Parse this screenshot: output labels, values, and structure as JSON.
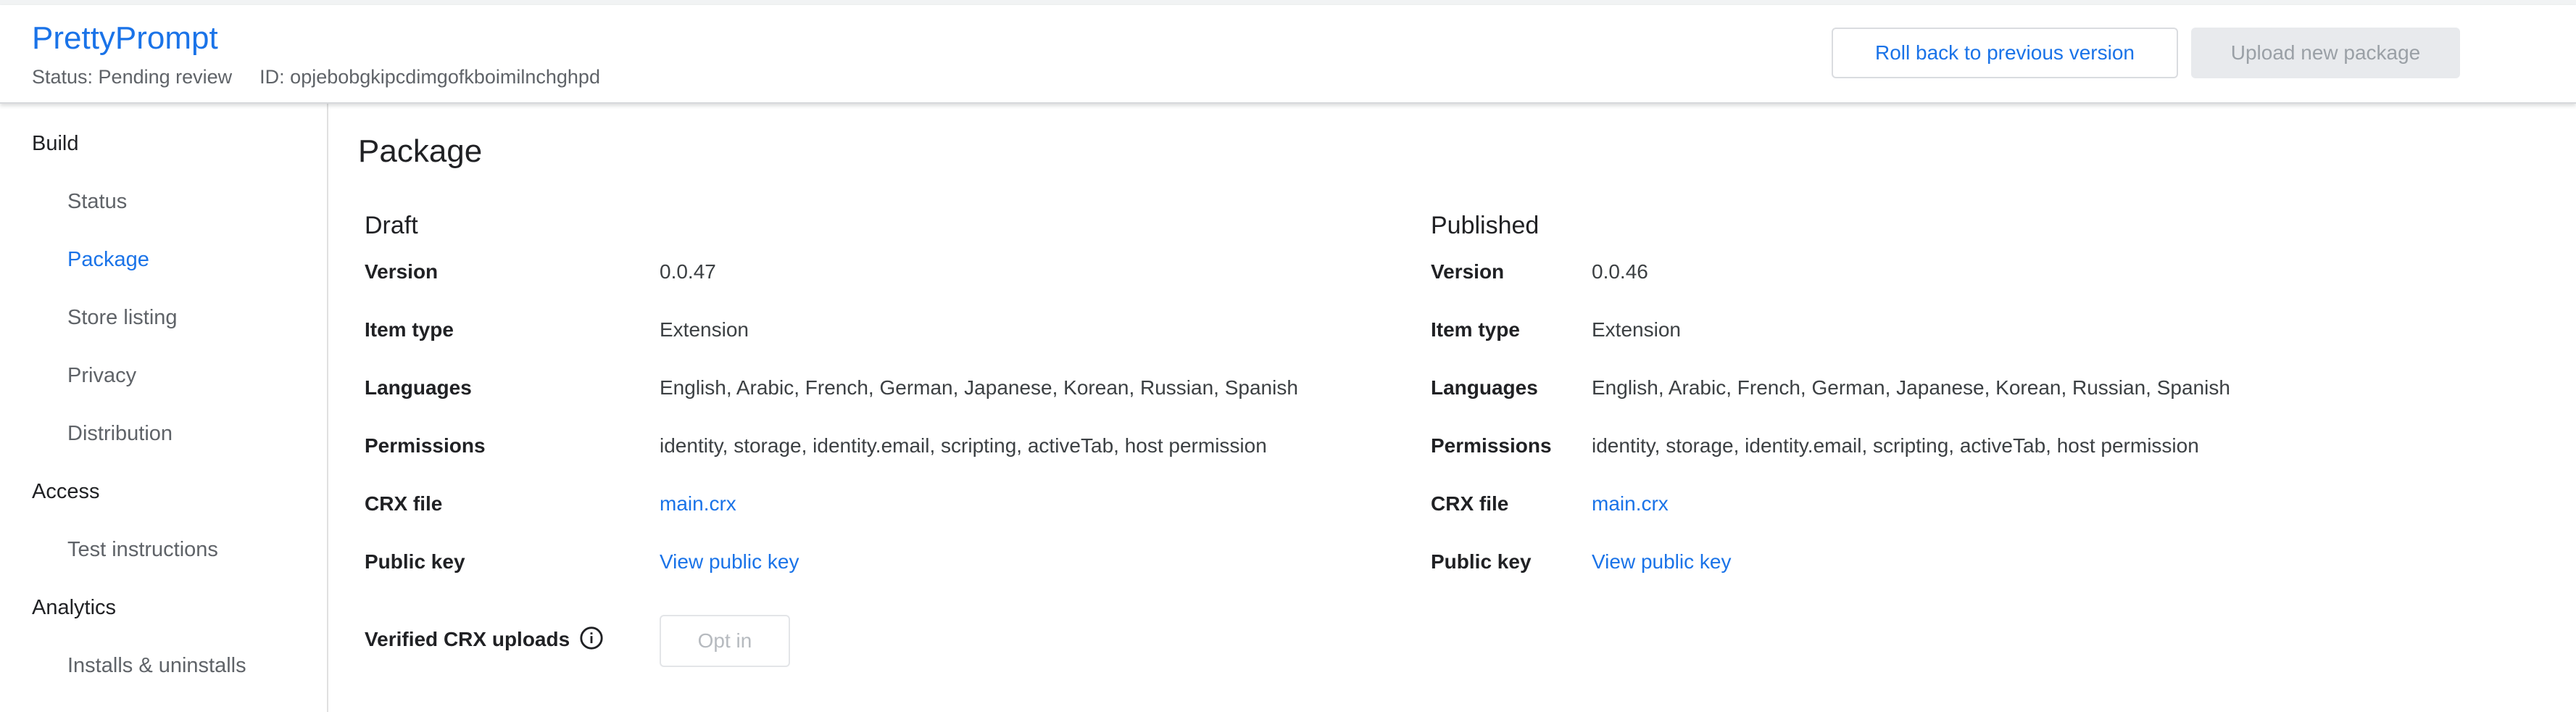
{
  "header": {
    "app_title": "PrettyPrompt",
    "status": "Status: Pending review",
    "id": "ID: opjebobgkipcdimgofkboimilnchghpd",
    "rollback_label": "Roll back to previous version",
    "upload_label": "Upload new package"
  },
  "sidebar": {
    "sections": [
      {
        "label": "Build",
        "items": [
          "Status",
          "Package",
          "Store listing",
          "Privacy",
          "Distribution"
        ]
      },
      {
        "label": "Access",
        "items": [
          "Test instructions"
        ]
      },
      {
        "label": "Analytics",
        "items": [
          "Installs & uninstalls"
        ]
      }
    ],
    "active_item": "Package"
  },
  "main": {
    "title": "Package",
    "draft": {
      "heading": "Draft",
      "rows": [
        {
          "label": "Version",
          "value": "0.0.47"
        },
        {
          "label": "Item type",
          "value": "Extension"
        },
        {
          "label": "Languages",
          "value": "English, Arabic, French, German, Japanese, Korean, Russian, Spanish"
        },
        {
          "label": "Permissions",
          "value": "identity, storage, identity.email, scripting, activeTab, host permission"
        },
        {
          "label": "CRX file",
          "value": "main.crx"
        },
        {
          "label": "Public key",
          "value": "View public key"
        }
      ],
      "verified_label": "Verified CRX uploads",
      "optin_label": "Opt in"
    },
    "published": {
      "heading": "Published",
      "rows": [
        {
          "label": "Version",
          "value": "0.0.46"
        },
        {
          "label": "Item type",
          "value": "Extension"
        },
        {
          "label": "Languages",
          "value": "English, Arabic, French, German, Japanese, Korean, Russian, Spanish"
        },
        {
          "label": "Permissions",
          "value": "identity, storage, identity.email, scripting, activeTab, host permission"
        },
        {
          "label": "CRX file",
          "value": "main.crx"
        },
        {
          "label": "Public key",
          "value": "View public key"
        }
      ]
    }
  },
  "icons": {
    "info": "info-icon"
  },
  "colors": {
    "accent": "#1a73e8",
    "text": "#202124",
    "muted": "#5f6368",
    "disabled": "#9aa0a6"
  }
}
